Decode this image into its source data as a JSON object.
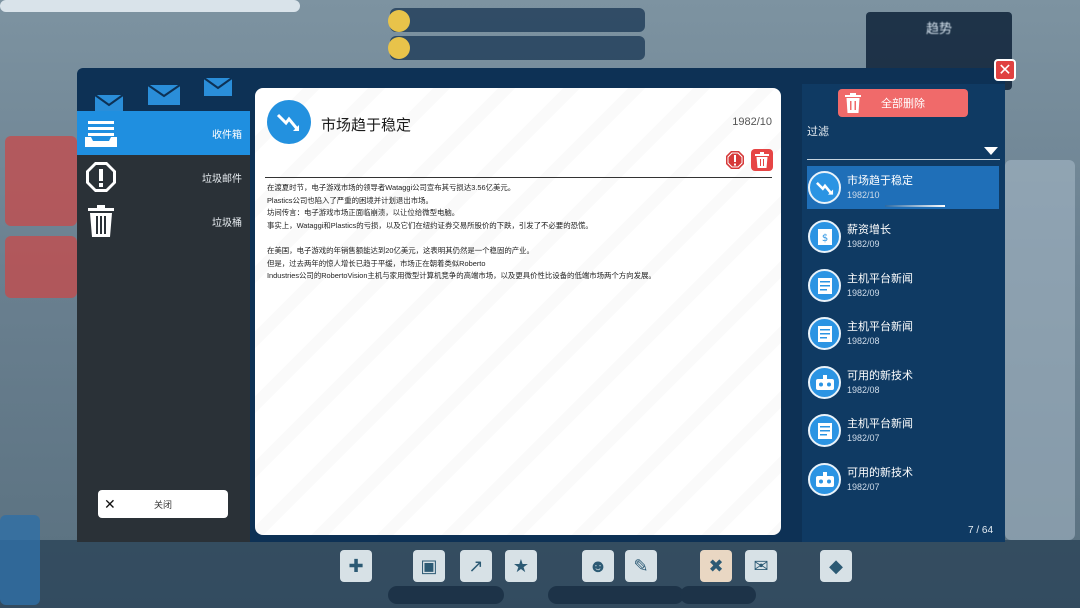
{
  "message": {
    "title": "市场趋于稳定",
    "date": "1982/10",
    "paragraphs": [
      "在渡夏时节，电子游戏市场的领导者Wataggi公司宣布其亏损达3.56亿美元。",
      "Plastics公司也陷入了严重的困境并计划退出市场。",
      "坊间传言：电子游戏市场正面临崩溃，以让位给微型电脑。",
      "事实上，Wataggi和Plastics的亏损，以及它们在纽约证券交易所股价的下跌，引发了不必要的恐慌。",
      "",
      "在美国，电子游戏的年销售额能达到20亿美元，这表明其仍然是一个稳固的产业。",
      "但是，过去两年的惊人增长已趋于平缓，市场正在朝着类似Roberto",
      "Industries公司的RobertoVision主机与家用微型计算机竞争的高端市场，以及更具价性比设备的低端市场两个方向发展。"
    ]
  },
  "sidebar": {
    "items": [
      {
        "label": "收件箱",
        "icon": "inbox-icon"
      },
      {
        "label": "垃圾邮件",
        "icon": "spam-warning-icon"
      },
      {
        "label": "垃圾桶",
        "icon": "trash-icon"
      }
    ],
    "close_label": "关闭"
  },
  "right_panel": {
    "delete_all_label": "全部删除",
    "filter_label": "过滤",
    "items": [
      {
        "title": "市场趋于稳定",
        "date": "1982/10",
        "icon": "market-crash-icon"
      },
      {
        "title": "薪资增长",
        "date": "1982/09",
        "icon": "salary-icon"
      },
      {
        "title": "主机平台新闻",
        "date": "1982/09",
        "icon": "news-icon"
      },
      {
        "title": "主机平台新闻",
        "date": "1982/08",
        "icon": "news-icon"
      },
      {
        "title": "可用的新技术",
        "date": "1982/08",
        "icon": "tech-icon"
      },
      {
        "title": "主机平台新闻",
        "date": "1982/07",
        "icon": "news-icon"
      },
      {
        "title": "可用的新技术",
        "date": "1982/07",
        "icon": "tech-icon"
      }
    ],
    "page_count": "7 / 64"
  },
  "background": {
    "trend_title": "趋势"
  },
  "colors": {
    "accent_blue": "#1f8fe0",
    "delete_red": "#f06a6a",
    "panel_navy": "#0f3a63"
  }
}
